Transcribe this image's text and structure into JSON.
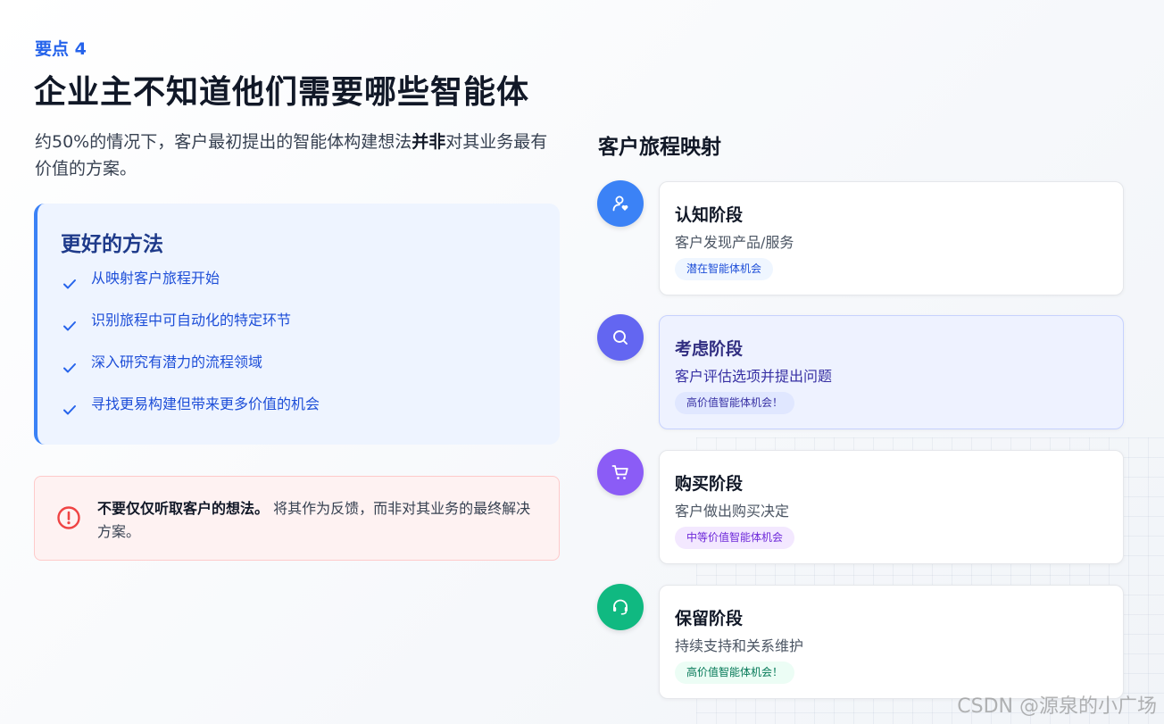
{
  "header": {
    "kicker": "要点 4",
    "title": "企业主不知道他们需要哪些智能体"
  },
  "intro": {
    "before": "约50%的情况下，客户最初提出的智能体构建想法",
    "emphasis": "并非",
    "after": "对其业务最有价值的方案。"
  },
  "better_method": {
    "title": "更好的方法",
    "items": [
      "从映射客户旅程开始",
      "识别旅程中可自动化的特定环节",
      "深入研究有潜力的流程领域",
      "寻找更易构建但带来更多价值的机会"
    ]
  },
  "warning": {
    "bold": "不要仅仅听取客户的想法。",
    "text": "将其作为反馈，而非对其业务的最终解决方案。"
  },
  "journey": {
    "title": "客户旅程映射",
    "stages": [
      {
        "name": "认知阶段",
        "desc": "客户发现产品/服务",
        "badge": "潜在智能体机会",
        "icon": "user-heart-icon",
        "icon_color": "#3b82f6",
        "badge_bg": "#eff6ff",
        "badge_color": "#1d4ed8",
        "active": false
      },
      {
        "name": "考虑阶段",
        "desc": "客户评估选项并提出问题",
        "badge": "高价值智能体机会！",
        "icon": "search-icon",
        "icon_color": "#6366f1",
        "badge_bg": "#e0e7ff",
        "badge_color": "#3730a3",
        "active": true
      },
      {
        "name": "购买阶段",
        "desc": "客户做出购买决定",
        "badge": "中等价值智能体机会",
        "icon": "cart-icon",
        "icon_color": "#8b5cf6",
        "badge_bg": "#f3e8ff",
        "badge_color": "#6d28d9",
        "active": false
      },
      {
        "name": "保留阶段",
        "desc": "持续支持和关系维护",
        "badge": "高价值智能体机会！",
        "icon": "headset-icon",
        "icon_color": "#10b981",
        "badge_bg": "#ecfdf5",
        "badge_color": "#047857",
        "active": false
      }
    ]
  },
  "watermark": "CSDN @源泉的小广场"
}
